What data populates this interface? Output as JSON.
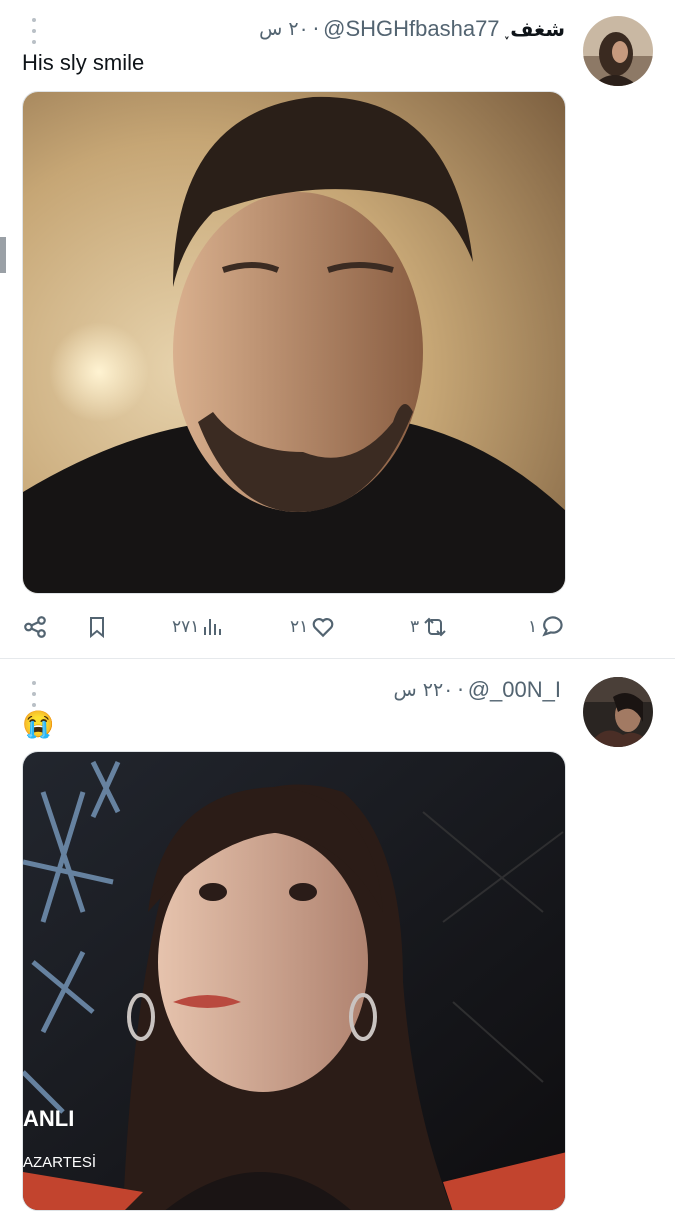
{
  "tweets": [
    {
      "display_name": "شغف",
      "verified_mark": "˯",
      "handle": "@SHGHfbasha77",
      "time": "٢٠ س",
      "text": "His sly smile",
      "actions": {
        "reply_count": "١",
        "retweet_count": "٣",
        "like_count": "٢١",
        "views_count": "٢٧١"
      }
    },
    {
      "display_name": "",
      "handle": "@_00N_I",
      "time": "٢٢٠ س",
      "text": "😭",
      "media_overlay": {
        "line1": "ANLI",
        "line2": "AZARTESİ"
      }
    }
  ],
  "icons": {
    "reply": "reply-icon",
    "retweet": "retweet-icon",
    "like": "heart-icon",
    "views": "views-icon",
    "bookmark": "bookmark-icon",
    "share": "share-icon",
    "more": "more-vertical-icon"
  },
  "colors": {
    "text_primary": "#0f1419",
    "text_secondary": "#536471",
    "divider": "#e6e9ec"
  }
}
